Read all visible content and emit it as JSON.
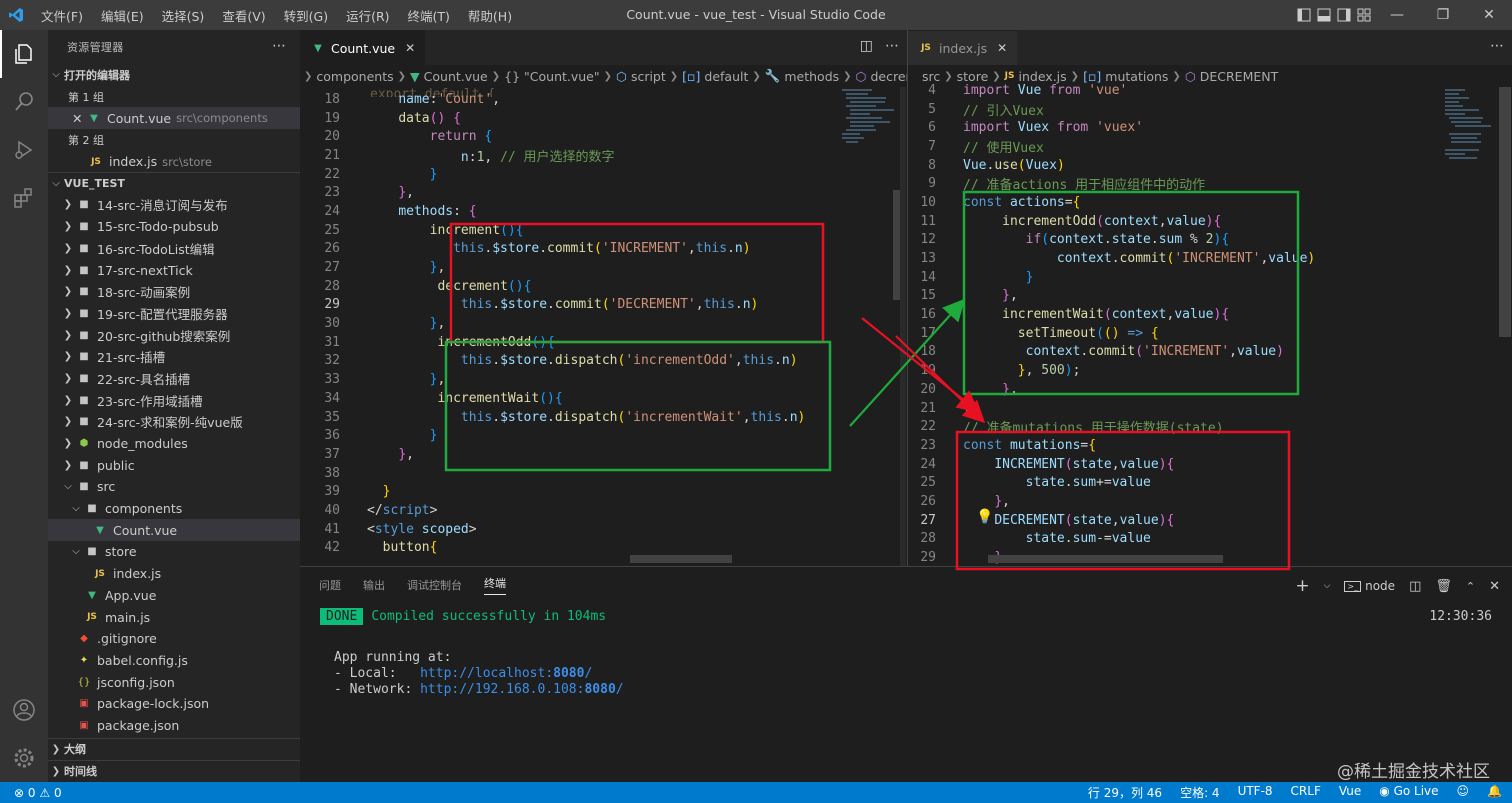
{
  "titlebar": {
    "menu": [
      "文件(F)",
      "编辑(E)",
      "选择(S)",
      "查看(V)",
      "转到(G)",
      "运行(R)",
      "终端(T)",
      "帮助(H)"
    ],
    "title": "Count.vue - vue_test - Visual Studio Code"
  },
  "sidebar": {
    "title": "资源管理器",
    "open_editors": "打开的编辑器",
    "group1": "第 1 组",
    "group1_file": "Count.vue",
    "group1_desc": "src\\components",
    "group2": "第 2 组",
    "group2_file": "index.js",
    "group2_desc": "src\\store",
    "project": "VUE_TEST",
    "folders": [
      "14-src-消息订阅与发布",
      "15-src-Todo-pubsub",
      "16-src-TodoList编辑",
      "17-src-nextTick",
      "18-src-动画案例",
      "19-src-配置代理服务器",
      "20-src-github搜索案例",
      "21-src-插槽",
      "22-src-具名插槽",
      "23-src-作用域插槽",
      "24-src-求和案例-纯vue版"
    ],
    "node_modules": "node_modules",
    "public": "public",
    "src": "src",
    "components": "components",
    "count_vue": "Count.vue",
    "store": "store",
    "index_js": "index.js",
    "app_vue": "App.vue",
    "main_js": "main.js",
    "gitignore": ".gitignore",
    "babel": "babel.config.js",
    "jsconfig": "jsconfig.json",
    "pkglock": "package-lock.json",
    "pkg": "package.json",
    "outline": "大纲",
    "timeline": "时间线"
  },
  "left_editor": {
    "tab": "Count.vue",
    "breadcrumb": [
      "components",
      "Count.vue",
      "{} \"Count.vue\"",
      "script",
      "default",
      "methods",
      "decrement"
    ],
    "lines": [
      {
        "n": "18",
        "h": "<span class='var'>name</span><span class='pun'>:</span><span class='str'>'Count'</span><span class='pun'>,</span>",
        "i": 4
      },
      {
        "n": "19",
        "h": "<span class='fn'>data</span><span class='br2'>()</span> <span class='br2'>{</span>",
        "i": 4
      },
      {
        "n": "20",
        "h": "<span class='kw2'>return</span> <span class='br3'>{</span>",
        "i": 8
      },
      {
        "n": "21",
        "h": "<span class='var'>n</span><span class='pun'>:</span><span class='num'>1</span><span class='pun'>,</span> <span class='cm'>// 用户选择的数字</span>",
        "i": 12
      },
      {
        "n": "22",
        "h": "<span class='br3'>}</span>",
        "i": 8
      },
      {
        "n": "23",
        "h": "<span class='br2'>}</span><span class='pun'>,</span>",
        "i": 4
      },
      {
        "n": "24",
        "h": "<span class='var'>methods</span><span class='pun'>:</span> <span class='br2'>{</span>",
        "i": 4
      },
      {
        "n": "25",
        "h": "<span class='fn'>increment</span><span class='br3'>()</span><span class='br3'>{</span>",
        "i": 8
      },
      {
        "n": "26",
        "h": "<span class='kw'>this</span><span class='pun'>.</span><span class='var'>$store</span><span class='pun'>.</span><span class='fn'>commit</span><span class='br1'>(</span><span class='str'>'INCREMENT'</span><span class='pun'>,</span><span class='kw'>this</span><span class='pun'>.</span><span class='var'>n</span><span class='br1'>)</span>",
        "i": 11
      },
      {
        "n": "27",
        "h": "<span class='br3'>}</span><span class='pun'>,</span>",
        "i": 8
      },
      {
        "n": "28",
        "h": "<span class='fn'>decrement</span><span class='br3'>()</span><span class='br3'>{</span>",
        "i": 9
      },
      {
        "n": "29",
        "h": "<span class='kw'>this</span><span class='pun'>.</span><span class='var'>$store</span><span class='pun'>.</span><span class='fn'>commit</span><span class='br1'>(</span><span class='str'>'DECREMENT'</span><span class='pun'>,</span><span class='kw'>this</span><span class='pun'>.</span><span class='var'>n</span><span class='br1'>)</span>",
        "i": 12,
        "cur": true
      },
      {
        "n": "30",
        "h": "<span class='br3'>}</span><span class='pun'>,</span>",
        "i": 8
      },
      {
        "n": "31",
        "h": "<span class='fn'>incrementOdd</span><span class='br3'>()</span><span class='br3'>{</span>",
        "i": 9
      },
      {
        "n": "32",
        "h": "<span class='kw'>this</span><span class='pun'>.</span><span class='var'>$store</span><span class='pun'>.</span><span class='fn'>dispatch</span><span class='br1'>(</span><span class='str'>'incrementOdd'</span><span class='pun'>,</span><span class='kw'>this</span><span class='pun'>.</span><span class='var'>n</span><span class='br1'>)</span>",
        "i": 12
      },
      {
        "n": "33",
        "h": "<span class='br3'>}</span><span class='pun'>,</span>",
        "i": 8
      },
      {
        "n": "34",
        "h": "<span class='fn'>incrementWait</span><span class='br3'>()</span><span class='br3'>{</span>",
        "i": 9
      },
      {
        "n": "35",
        "h": "<span class='kw'>this</span><span class='pun'>.</span><span class='var'>$store</span><span class='pun'>.</span><span class='fn'>dispatch</span><span class='br1'>(</span><span class='str'>'incrementWait'</span><span class='pun'>,</span><span class='kw'>this</span><span class='pun'>.</span><span class='var'>n</span><span class='br1'>)</span>",
        "i": 12
      },
      {
        "n": "36",
        "h": "<span class='br3'>}</span>",
        "i": 8
      },
      {
        "n": "37",
        "h": "<span class='br2'>}</span><span class='pun'>,</span>",
        "i": 4
      },
      {
        "n": "38",
        "h": "",
        "i": 0
      },
      {
        "n": "39",
        "h": "<span class='br1'>}</span>",
        "i": 2
      },
      {
        "n": "40",
        "h": "<span class='pun'>&lt;/</span><span class='tag'>script</span><span class='pun'>&gt;</span>",
        "i": 0
      },
      {
        "n": "41",
        "h": "<span class='pun'>&lt;</span><span class='tag'>style</span> <span class='attr'>scoped</span><span class='pun'>&gt;</span>",
        "i": 0
      },
      {
        "n": "42",
        "h": "<span class='fn'>button</span><span class='br1'>{</span>",
        "i": 2
      }
    ]
  },
  "right_editor": {
    "tab": "index.js",
    "breadcrumb": [
      "src",
      "store",
      "index.js",
      "mutations",
      "DECREMENT"
    ],
    "lines": [
      {
        "n": "4",
        "h": "<span class='kw2'>import</span> <span class='var'>Vue</span> <span class='kw2'>from</span> <span class='str'>'vue'</span>",
        "i": 0
      },
      {
        "n": "5",
        "h": "<span class='cm'>// 引入Vuex</span>",
        "i": 0
      },
      {
        "n": "6",
        "h": "<span class='kw2'>import</span> <span class='var'>Vuex</span> <span class='kw2'>from</span> <span class='str'>'vuex'</span>",
        "i": 0
      },
      {
        "n": "7",
        "h": "<span class='cm'>// 使用Vuex</span>",
        "i": 0
      },
      {
        "n": "8",
        "h": "<span class='var'>Vue</span><span class='pun'>.</span><span class='fn'>use</span><span class='br1'>(</span><span class='var'>Vuex</span><span class='br1'>)</span>",
        "i": 0
      },
      {
        "n": "9",
        "h": "<span class='cm'>// 准备actions 用于相应组件中的动作</span>",
        "i": 0
      },
      {
        "n": "10",
        "h": "<span class='kw'>const</span> <span class='var'>actions</span><span class='pun'>=</span><span class='br1'>{</span>",
        "i": 0
      },
      {
        "n": "11",
        "h": "<span class='fn'>incrementOdd</span><span class='br2'>(</span><span class='var'>context</span><span class='pun'>,</span><span class='var'>value</span><span class='br2'>)</span><span class='br2'>{</span>",
        "i": 5
      },
      {
        "n": "12",
        "h": "<span class='kw2'>if</span><span class='br3'>(</span><span class='var'>context</span><span class='pun'>.</span><span class='var'>state</span><span class='pun'>.</span><span class='var'>sum</span> <span class='pun'>%</span> <span class='num'>2</span><span class='br3'>)</span><span class='br3'>{</span>",
        "i": 8
      },
      {
        "n": "13",
        "h": "<span class='var'>context</span><span class='pun'>.</span><span class='fn'>commit</span><span class='br1'>(</span><span class='str'>'INCREMENT'</span><span class='pun'>,</span><span class='var'>value</span><span class='br1'>)</span>",
        "i": 12
      },
      {
        "n": "14",
        "h": "<span class='br3'>}</span>",
        "i": 8
      },
      {
        "n": "15",
        "h": "<span class='br2'>}</span><span class='pun'>,</span>",
        "i": 5
      },
      {
        "n": "16",
        "h": "<span class='fn'>incrementWait</span><span class='br2'>(</span><span class='var'>context</span><span class='pun'>,</span><span class='var'>value</span><span class='br2'>)</span><span class='br2'>{</span>",
        "i": 5
      },
      {
        "n": "17",
        "h": "<span class='fn'>setTimeout</span><span class='br3'>(</span><span class='br1'>()</span> <span class='kw'>=&gt;</span> <span class='br1'>{</span>",
        "i": 7
      },
      {
        "n": "18",
        "h": "<span class='var'>context</span><span class='pun'>.</span><span class='fn'>commit</span><span class='br2'>(</span><span class='str'>'INCREMENT'</span><span class='pun'>,</span><span class='var'>value</span><span class='br2'>)</span>",
        "i": 8
      },
      {
        "n": "19",
        "h": "<span class='br1'>}</span><span class='pun'>,</span> <span class='num'>500</span><span class='br3'>)</span><span class='pun'>;</span>",
        "i": 7
      },
      {
        "n": "20",
        "h": "<span class='br2'>}</span><span class='pun'>,</span>",
        "i": 5
      },
      {
        "n": "21",
        "h": "<span class='br1'>}</span>",
        "i": 0
      },
      {
        "n": "22",
        "h": "<span class='cm'>// 准备mutations 用于操作数据(state)</span>",
        "i": 0
      },
      {
        "n": "23",
        "h": "<span class='kw'>const</span> <span class='var'>mutations</span><span class='pun'>=</span><span class='br1'>{</span>",
        "i": 0
      },
      {
        "n": "24",
        "h": "<span class='var'>INCREMENT</span><span class='br2'>(</span><span class='var'>state</span><span class='pun'>,</span><span class='var'>value</span><span class='br2'>)</span><span class='br2'>{</span>",
        "i": 4
      },
      {
        "n": "25",
        "h": "<span class='var'>state</span><span class='pun'>.</span><span class='var'>sum</span><span class='pun'>+=</span><span class='var'>value</span>",
        "i": 8
      },
      {
        "n": "26",
        "h": "<span class='br2'>}</span><span class='pun'>,</span>",
        "i": 4
      },
      {
        "n": "27",
        "h": "<span class='var'>DECREMENT</span><span class='br2'>(</span><span class='var'>state</span><span class='pun'>,</span><span class='var'>value</span><span class='br2'>)</span><span class='br2'>{</span>",
        "i": 4,
        "cur": true
      },
      {
        "n": "28",
        "h": "<span class='var'>state</span><span class='pun'>.</span><span class='var'>sum</span><span class='pun'>-=</span><span class='var'>value</span>",
        "i": 8
      },
      {
        "n": "29",
        "h": "<span class='br2'>}</span>",
        "i": 4
      }
    ]
  },
  "panel": {
    "tabs": [
      "问题",
      "输出",
      "调试控制台",
      "终端"
    ],
    "terminal_name": "node",
    "done": "DONE",
    "compiled": "Compiled successfully in 104ms",
    "time": "12:30:36",
    "app_running": "App running at:",
    "local_label": "- Local:   ",
    "local_url": "http://localhost:",
    "local_port": "8080",
    "network_label": "- Network: ",
    "network_url": "http://192.168.0.108:",
    "network_port": "8080"
  },
  "status": {
    "errors": "0",
    "warnings": "0",
    "position": "行 29，列 46",
    "spaces": "空格: 4",
    "encoding": "UTF-8",
    "eol": "CRLF",
    "lang": "Vue",
    "golive": "Go Live"
  },
  "watermark": "@稀土掘金技术社区",
  "colors": {
    "accent": "#007acc",
    "annotation_red": "#e81123",
    "annotation_green": "#1faa3c"
  }
}
